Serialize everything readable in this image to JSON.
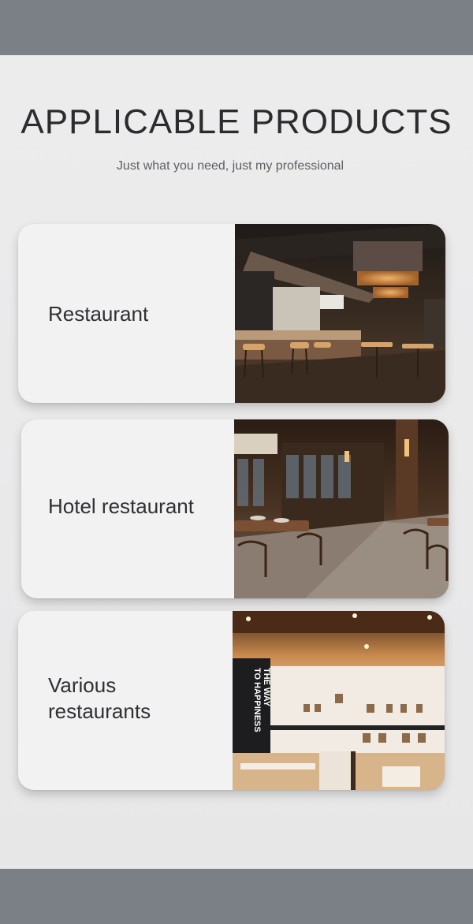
{
  "header": {
    "title": "APPLICABLE PRODUCTS",
    "subtitle": "Just what you need, just my professional"
  },
  "cards": [
    {
      "label": "Restaurant",
      "photo": "restaurant-bar-photo"
    },
    {
      "label": "Hotel restaurant",
      "photo": "hotel-restaurant-photo"
    },
    {
      "label_line1": "Various",
      "label_line2": "restaurants",
      "photo": "various-restaurants-photo",
      "wall_text_line1": "THE WAY",
      "wall_text_line2": "TO HAPPINESS"
    }
  ],
  "colors": {
    "bar": "#7b8087",
    "background": "#eaeaeb",
    "card": "#f2f2f3",
    "text": "#303033"
  }
}
